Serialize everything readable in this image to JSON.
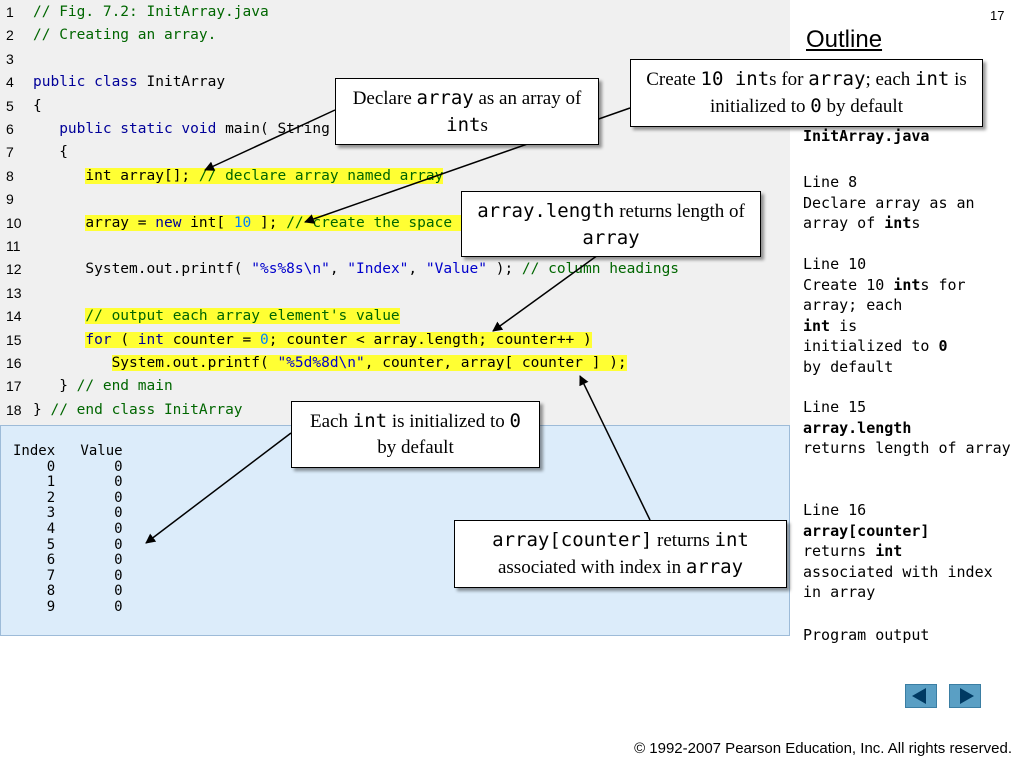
{
  "page_number": "17",
  "outline_title": "Outline",
  "code_lines": [
    {
      "n": "1",
      "parts": [
        {
          "t": "// Fig. 7.2: InitArray.java",
          "c": "cm"
        }
      ]
    },
    {
      "n": "2",
      "parts": [
        {
          "t": "// Creating an array.",
          "c": "cm"
        }
      ]
    },
    {
      "n": "3",
      "parts": []
    },
    {
      "n": "4",
      "parts": [
        {
          "t": "public class ",
          "c": "kw"
        },
        {
          "t": "InitArray",
          "c": ""
        }
      ]
    },
    {
      "n": "5",
      "parts": [
        {
          "t": "{",
          "c": ""
        }
      ]
    },
    {
      "n": "6",
      "parts": [
        {
          "t": "   ",
          "c": ""
        },
        {
          "t": "public static void ",
          "c": "kw"
        },
        {
          "t": "main( String args[] )",
          "c": ""
        }
      ]
    },
    {
      "n": "7",
      "parts": [
        {
          "t": "   {",
          "c": ""
        }
      ]
    },
    {
      "n": "8",
      "parts": [
        {
          "t": "      ",
          "c": ""
        },
        {
          "t": "int array[]; ",
          "c": "hl"
        },
        {
          "t": "// declare array named array",
          "c": "cm hl"
        }
      ]
    },
    {
      "n": "9",
      "parts": []
    },
    {
      "n": "10",
      "parts": [
        {
          "t": "      ",
          "c": ""
        },
        {
          "t": "array = ",
          "c": "hl"
        },
        {
          "t": "new ",
          "c": "kw hl"
        },
        {
          "t": "int[ ",
          "c": "hl"
        },
        {
          "t": "10",
          "c": "num hl"
        },
        {
          "t": " ]; ",
          "c": "hl"
        },
        {
          "t": "// create the space for array",
          "c": "cm hl"
        }
      ]
    },
    {
      "n": "11",
      "parts": []
    },
    {
      "n": "12",
      "parts": [
        {
          "t": "      System.out.printf( ",
          "c": ""
        },
        {
          "t": "\"%s%8s\\n\"",
          "c": "st"
        },
        {
          "t": ", ",
          "c": ""
        },
        {
          "t": "\"Index\"",
          "c": "st"
        },
        {
          "t": ", ",
          "c": ""
        },
        {
          "t": "\"Value\"",
          "c": "st"
        },
        {
          "t": " ); ",
          "c": ""
        },
        {
          "t": "// column headings",
          "c": "cm"
        }
      ]
    },
    {
      "n": "13",
      "parts": []
    },
    {
      "n": "14",
      "parts": [
        {
          "t": "      ",
          "c": ""
        },
        {
          "t": "// output each array element's value",
          "c": "cm hl"
        }
      ]
    },
    {
      "n": "15",
      "parts": [
        {
          "t": "      ",
          "c": ""
        },
        {
          "t": "for ",
          "c": "kw hl"
        },
        {
          "t": "( ",
          "c": "hl"
        },
        {
          "t": "int ",
          "c": "kw hl"
        },
        {
          "t": "counter = ",
          "c": "hl"
        },
        {
          "t": "0",
          "c": "num hl"
        },
        {
          "t": "; counter < array.length; counter++ )",
          "c": "hl"
        }
      ]
    },
    {
      "n": "16",
      "parts": [
        {
          "t": "         ",
          "c": ""
        },
        {
          "t": "System.out.printf( ",
          "c": "hl"
        },
        {
          "t": "\"%5d%8d\\n\"",
          "c": "st hl"
        },
        {
          "t": ", counter, array[ counter ] );",
          "c": "hl"
        }
      ]
    },
    {
      "n": "17",
      "parts": [
        {
          "t": "   } ",
          "c": ""
        },
        {
          "t": "// end main",
          "c": "cm"
        }
      ]
    },
    {
      "n": "18",
      "parts": [
        {
          "t": "} ",
          "c": ""
        },
        {
          "t": "// end class InitArray",
          "c": "cm"
        }
      ]
    }
  ],
  "output_lines": [
    "Index   Value",
    "    0       0",
    "    1       0",
    "    2       0",
    "    3       0",
    "    4       0",
    "    5       0",
    "    6       0",
    "    7       0",
    "    8       0",
    "    9       0"
  ],
  "callouts": {
    "declare": [
      {
        "t": "Declare ",
        "m": false
      },
      {
        "t": "array",
        "m": true
      },
      {
        "t": " as an array of ",
        "m": false
      },
      {
        "t": "int",
        "m": true
      },
      {
        "t": "s",
        "m": false
      }
    ],
    "create": [
      {
        "t": "Create ",
        "m": false
      },
      {
        "t": "10 int",
        "m": true
      },
      {
        "t": "s for ",
        "m": false
      },
      {
        "t": "array",
        "m": true
      },
      {
        "t": "; each ",
        "m": false
      },
      {
        "t": "int",
        "m": true
      },
      {
        "t": " is initialized to ",
        "m": false
      },
      {
        "t": "0",
        "m": true
      },
      {
        "t": " by default",
        "m": false
      }
    ],
    "length": [
      {
        "t": "array.length",
        "m": true
      },
      {
        "t": " returns length of ",
        "m": false
      },
      {
        "t": "array",
        "m": true
      }
    ],
    "each_int": [
      {
        "t": "Each ",
        "m": false
      },
      {
        "t": "int",
        "m": true
      },
      {
        "t": " is initialized to ",
        "m": false
      },
      {
        "t": "0",
        "m": true
      },
      {
        "t": " by default",
        "m": false
      }
    ],
    "counter": [
      {
        "t": "array[counter]",
        "m": true
      },
      {
        "t": " returns ",
        "m": false
      },
      {
        "t": "int",
        "m": true
      },
      {
        "t": " associated with index in ",
        "m": false
      },
      {
        "t": "array",
        "m": true
      }
    ]
  },
  "sidebar": {
    "file_name": "InitArray.java",
    "notes": [
      {
        "parts": [
          {
            "t": "Line 8\nDeclare array as an array of ",
            "b": false
          },
          {
            "t": "int",
            "b": true
          },
          {
            "t": "s",
            "b": false
          }
        ]
      },
      {
        "parts": [
          {
            "t": "Line 10\nCreate 10 ",
            "b": false
          },
          {
            "t": "int",
            "b": true
          },
          {
            "t": "s for array; each\n",
            "b": false
          },
          {
            "t": "int",
            "b": true
          },
          {
            "t": " is\ninitialized to ",
            "b": false
          },
          {
            "t": "0",
            "b": true
          },
          {
            "t": "\nby default",
            "b": false
          }
        ]
      },
      {
        "parts": [
          {
            "t": "Line 15\n",
            "b": false
          },
          {
            "t": "array.length",
            "b": true
          },
          {
            "t": "\nreturns length of array",
            "b": false
          }
        ]
      },
      {
        "parts": [
          {
            "t": "Line 16\n",
            "b": false
          },
          {
            "t": "array[counter]",
            "b": true
          },
          {
            "t": "\nreturns ",
            "b": false
          },
          {
            "t": "int",
            "b": true
          },
          {
            "t": "\nassociated with index in array",
            "b": false
          }
        ]
      },
      {
        "parts": [
          {
            "t": "Program output",
            "b": false
          }
        ]
      }
    ]
  },
  "nav": {
    "prev_icon": "triangle-left-icon",
    "next_icon": "triangle-right-icon",
    "button_color": "#5a9fc4"
  },
  "copyright": "© 1992-2007 Pearson Education, Inc.  All rights reserved."
}
